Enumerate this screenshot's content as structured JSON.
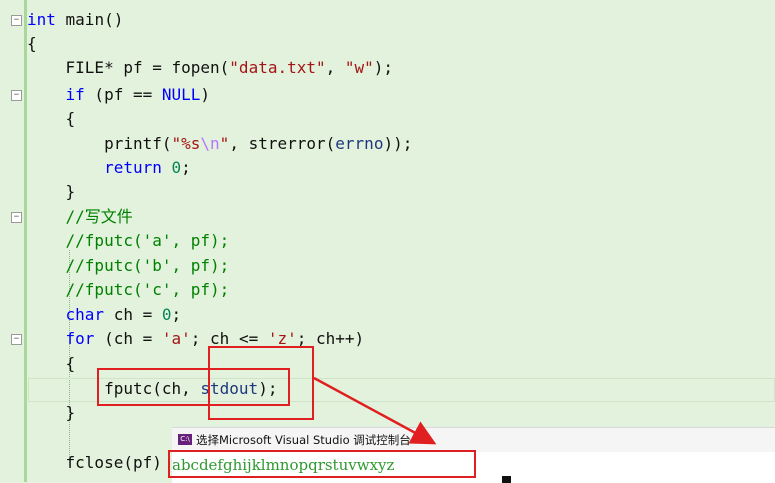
{
  "editor": {
    "lines": {
      "l0": {
        "kw": "int",
        "rest": " main()"
      },
      "l1": {
        "text": "{"
      },
      "l2": {
        "pre": "    FILE* pf = fopen(",
        "s1": "\"data.txt\"",
        "mid": ", ",
        "s2": "\"w\"",
        "post": ");"
      },
      "l3": {
        "kw": "if",
        "a": " (pf == ",
        "mac": "NULL",
        "b": ")"
      },
      "l4": {
        "text": "    {"
      },
      "l5": {
        "a": "printf(",
        "s1": "\"%s",
        "esc": "\\n",
        "s2": "\"",
        "b": ", strerror(",
        "v": "errno",
        "c": "));"
      },
      "l6": {
        "kw": "return",
        "sp": " ",
        "num": "0",
        "end": ";"
      },
      "l7": {
        "text": "    }"
      },
      "l8": {
        "cmt": "//写文件"
      },
      "l9": {
        "cmt": "//fputc('a', pf);"
      },
      "l10": {
        "cmt": "//fputc('b', pf);"
      },
      "l11": {
        "cmt": "//fputc('c', pf);"
      },
      "l12": {
        "kw": "char",
        "a": " ch = ",
        "num": "0",
        "end": ";"
      },
      "l13": {
        "kw": "for",
        "a": " (ch = ",
        "s1": "'a'",
        "b": "; ch <= ",
        "s2": "'z'",
        "c": "; ch++)"
      },
      "l14": {
        "text": "    {"
      },
      "l15": {
        "a": "fputc(ch, ",
        "v": "stdout",
        "b": ");"
      },
      "l16": {
        "text": "    }"
      },
      "l18": {
        "text": "    fclose(pf)"
      }
    }
  },
  "console": {
    "title": "选择Microsoft Visual Studio 调试控制台",
    "icon": "C:\\",
    "output": "abcdefghijklmnopqrstuvwxyz"
  },
  "colors": {
    "background": "#e3f2dc",
    "keyword": "#0000ff",
    "string": "#a31515",
    "comment": "#008000",
    "highlight": "#e02020",
    "console_output": "#2e9a2e"
  },
  "icons": [
    "fold-collapse-icon",
    "console-app-icon",
    "red-arrow"
  ]
}
